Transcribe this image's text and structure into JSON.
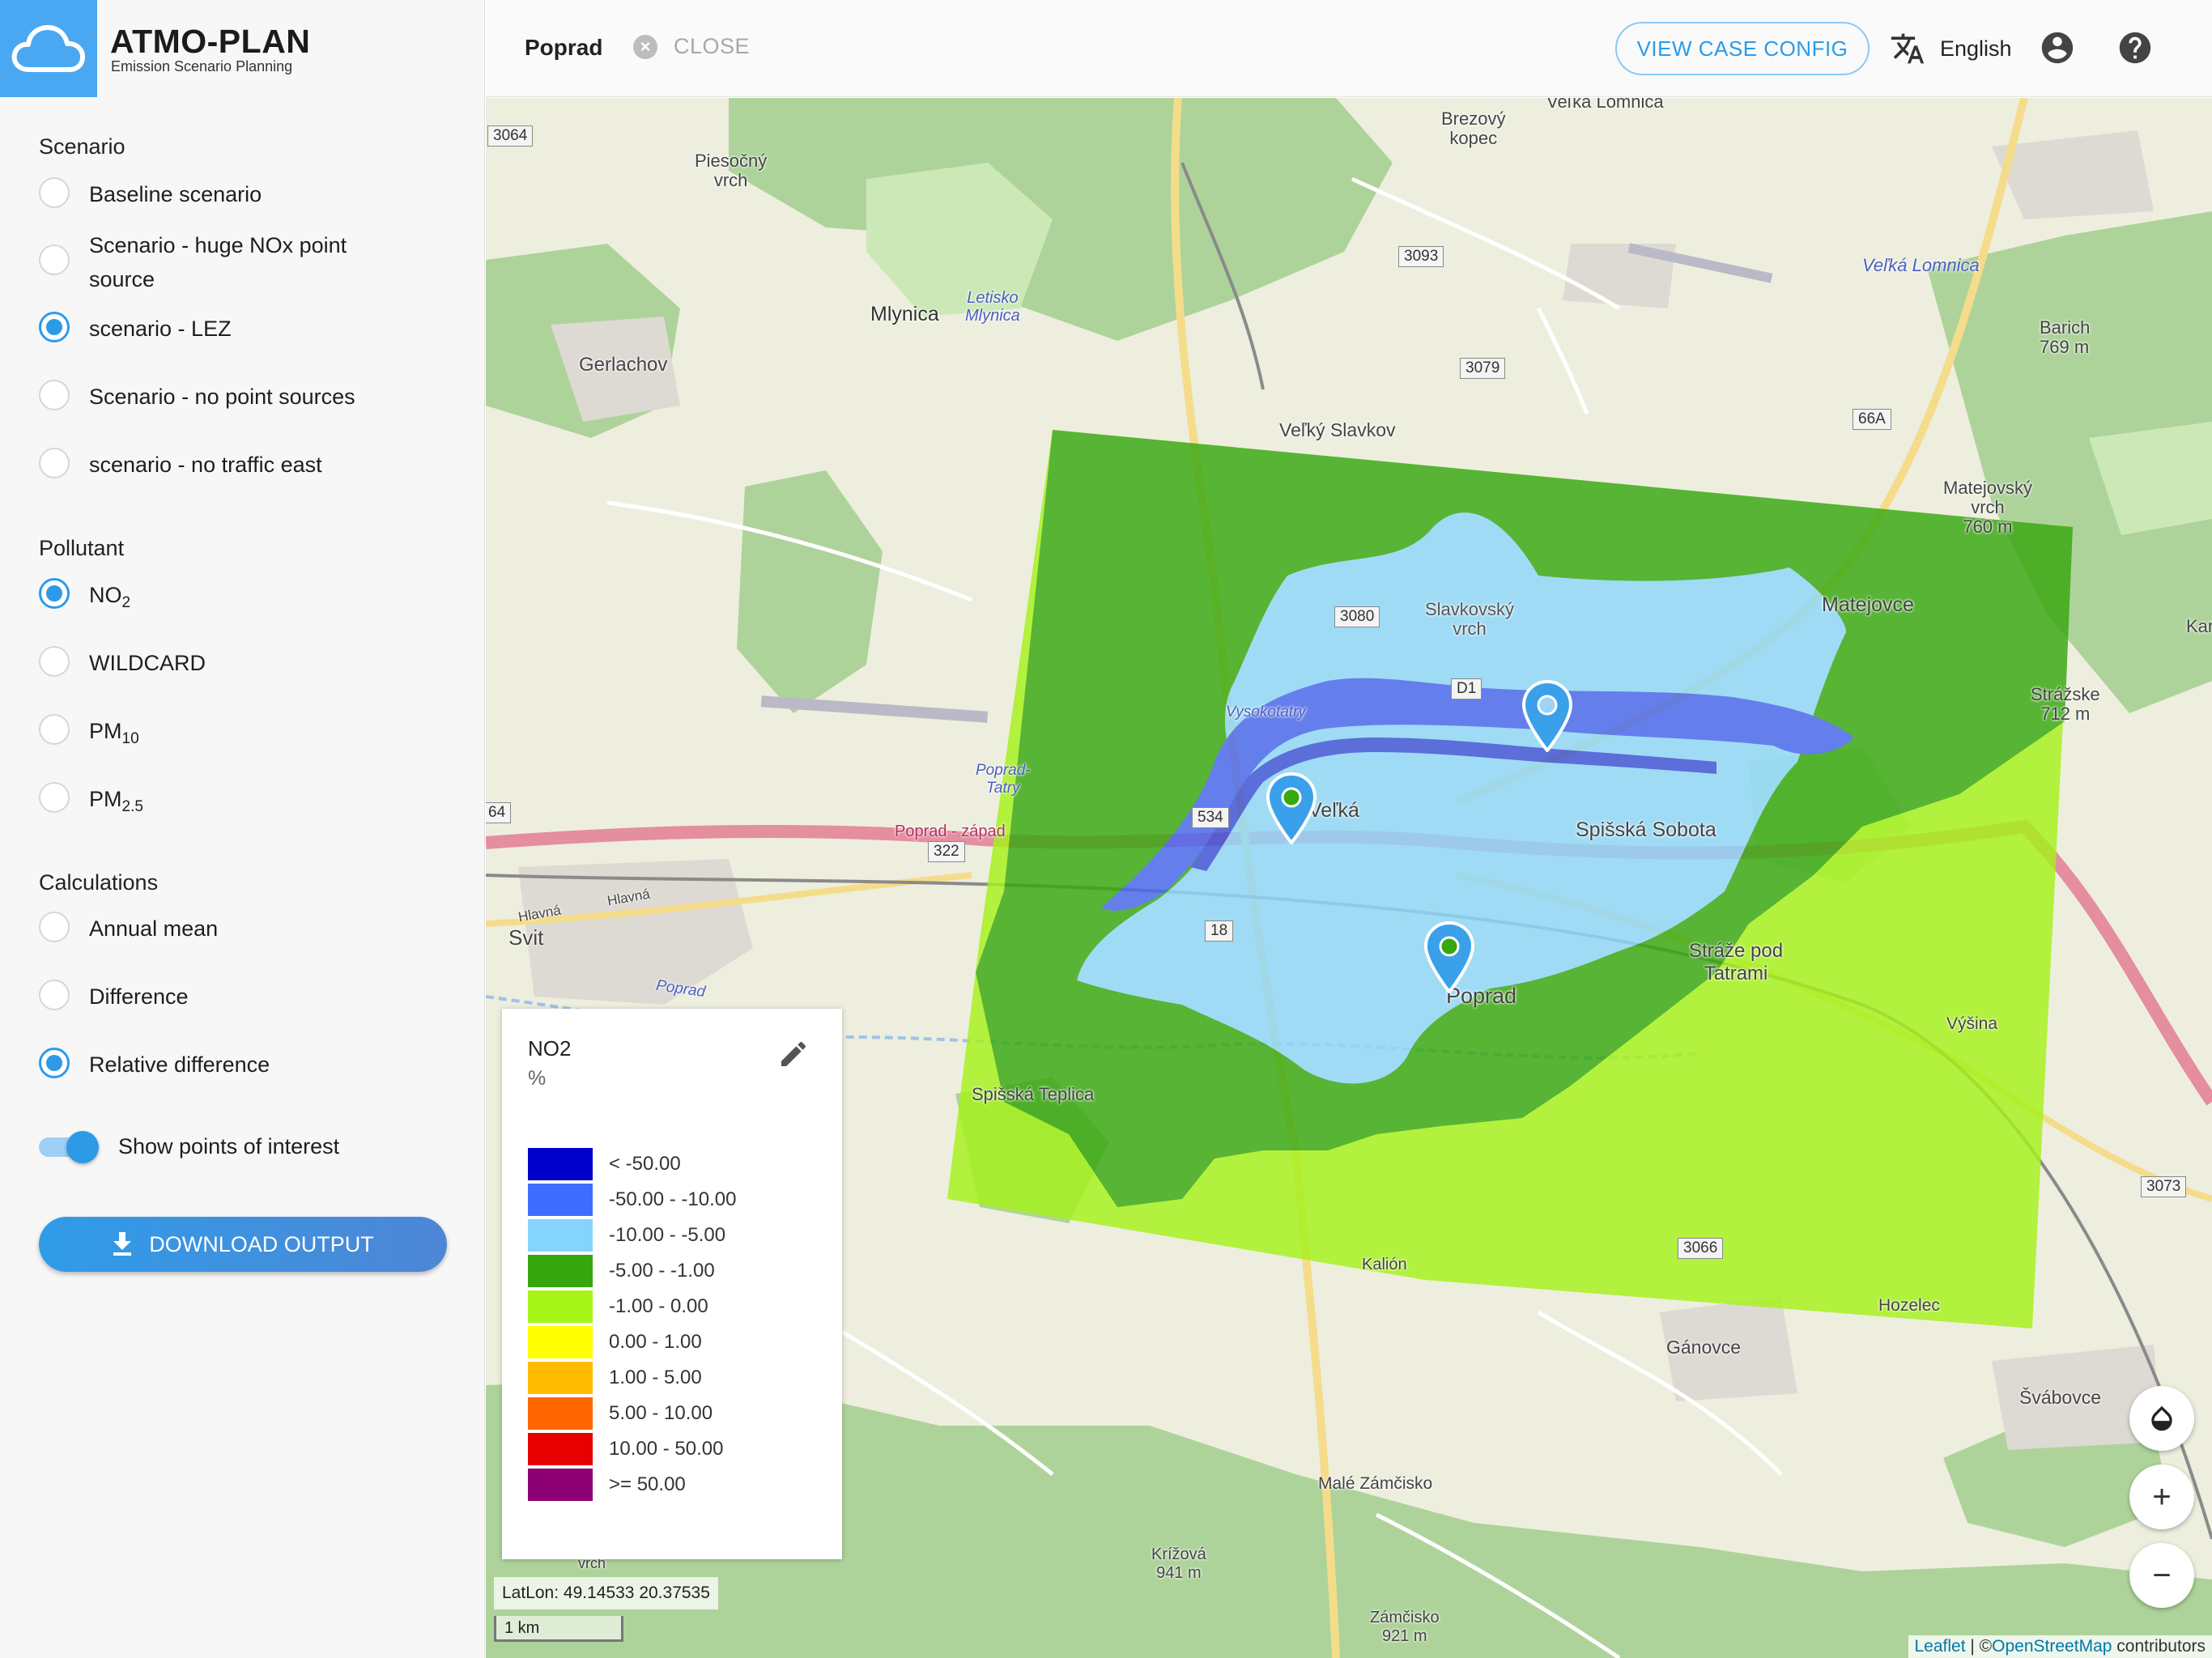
{
  "app": {
    "title": "ATMO-PLAN",
    "subtitle": "Emission Scenario Planning"
  },
  "sidebar": {
    "scenario_heading": "Scenario",
    "scenarios": [
      {
        "label": "Baseline scenario",
        "selected": false
      },
      {
        "label": "Scenario - huge NOx point source",
        "selected": false
      },
      {
        "label": "scenario - LEZ",
        "selected": true
      },
      {
        "label": "Scenario - no point sources",
        "selected": false
      },
      {
        "label": "scenario - no traffic east",
        "selected": false
      }
    ],
    "pollutant_heading": "Pollutant",
    "pollutants": [
      {
        "base": "NO",
        "sub": "2",
        "selected": true
      },
      {
        "base": "WILDCARD",
        "sub": "",
        "selected": false
      },
      {
        "base": "PM",
        "sub": "10",
        "selected": false
      },
      {
        "base": "PM",
        "sub": "2.5",
        "selected": false
      }
    ],
    "calculations_heading": "Calculations",
    "calculations": [
      {
        "label": "Annual mean",
        "selected": false
      },
      {
        "label": "Difference",
        "selected": false
      },
      {
        "label": "Relative difference",
        "selected": true
      }
    ],
    "poi_toggle": {
      "label": "Show points of interest",
      "on": true
    },
    "download_label": "DOWNLOAD OUTPUT"
  },
  "header": {
    "case_name": "Poprad",
    "close_label": "CLOSE",
    "view_config_label": "VIEW CASE CONFIG",
    "language": "English"
  },
  "legend": {
    "title": "NO2",
    "unit": "%",
    "items": [
      {
        "label": "< -50.00",
        "color": "#0000cc"
      },
      {
        "label": "-50.00 - -10.00",
        "color": "#3f6dff"
      },
      {
        "label": "-10.00 - -5.00",
        "color": "#85d4fb"
      },
      {
        "label": "-5.00 - -1.00",
        "color": "#35a60c"
      },
      {
        "label": "-1.00 - 0.00",
        "color": "#a7f516"
      },
      {
        "label": "0.00 - 1.00",
        "color": "#ffff00"
      },
      {
        "label": "1.00 - 5.00",
        "color": "#ffbb00"
      },
      {
        "label": "5.00 - 10.00",
        "color": "#ff6600"
      },
      {
        "label": "10.00 - 50.00",
        "color": "#e60000"
      },
      {
        "label": ">= 50.00",
        "color": "#8c0073"
      }
    ]
  },
  "map": {
    "latlon": "LatLon: 49.14533 20.37535",
    "scale": "1 km",
    "attribution": {
      "leaflet": "Leaflet",
      "sep": " | ©",
      "osm": "OpenStreetMap",
      "tail": " contributors"
    },
    "place_labels": {
      "velka_lomnica_top": "Veľká Lomnica",
      "brezovy_kopec": "Brezový\nkopec",
      "piesocny_vrch": "Piesočný\nvrch",
      "velka_lomnica_river": "Veľká Lomnica",
      "letisko": "Letisko\nMlynica",
      "mlynica": "Mlynica",
      "barich": "Barich\n769 m",
      "gerlachov": "Gerlachov",
      "velky_slavkov": "Veľký Slavkov",
      "matejovsky_vrch": "Matejovský\nvrch\n760 m",
      "slavkovsky_vrch": "Slavkovský\nvrch",
      "matejovce": "Matejovce",
      "vysokotatry": "Vysokotatry",
      "strazske": "Strážske\n712 m",
      "kar": "Kar",
      "poprad_tatry": "Poprad-\nTatry",
      "velka": "Veľká",
      "spisska_sobota": "Spišská Sobota",
      "poprad_zapad": "Poprad - západ",
      "svit": "Svit",
      "hlavna1": "Hlavná",
      "hlavna2": "Hlavná",
      "poprad_river": "Poprad",
      "straze": "Stráže pod\nTatrami",
      "poprad_city": "Poprad",
      "vysina": "Výšina",
      "spisska_teplica": "Spišská Teplica",
      "kalion": "Kalión",
      "hozelec": "Hozelec",
      "ganovce": "Gánovce",
      "svabovce": "Švábovce",
      "male_zamcisko": "Malé Zámčisko",
      "krizova": "Krížová\n941 m",
      "zamcisko": "Zámčisko\n921 m",
      "vrch": "vrch"
    },
    "road_shields": {
      "r3064": "3064",
      "r3093": "3093",
      "r3079": "3079",
      "r66a": "66A",
      "r3080": "3080",
      "rd1": "D1",
      "r534": "534",
      "r322": "322",
      "r18": "18",
      "r64": "64",
      "r3066": "3066",
      "r3073": "3073"
    },
    "markers": 3
  }
}
